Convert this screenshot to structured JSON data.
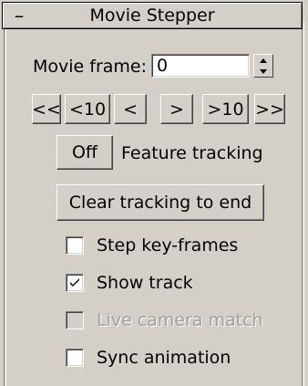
{
  "panel": {
    "toggle_symbol": "–",
    "title": "Movie Stepper"
  },
  "movie_frame": {
    "label": "Movie frame:",
    "value": "0"
  },
  "step_buttons": {
    "first": "<<",
    "back10": "<10",
    "back1": "<",
    "fwd1": ">",
    "fwd10": ">10",
    "last": ">>"
  },
  "feature_tracking": {
    "toggle_label": "Off",
    "label": "Feature tracking"
  },
  "clear_tracking": {
    "label": "Clear tracking to end"
  },
  "options": [
    {
      "label": "Step key-frames",
      "checked": false,
      "enabled": true
    },
    {
      "label": "Show track",
      "checked": true,
      "enabled": true
    },
    {
      "label": "Live camera match",
      "checked": false,
      "enabled": false
    },
    {
      "label": "Sync animation",
      "checked": false,
      "enabled": true
    }
  ]
}
